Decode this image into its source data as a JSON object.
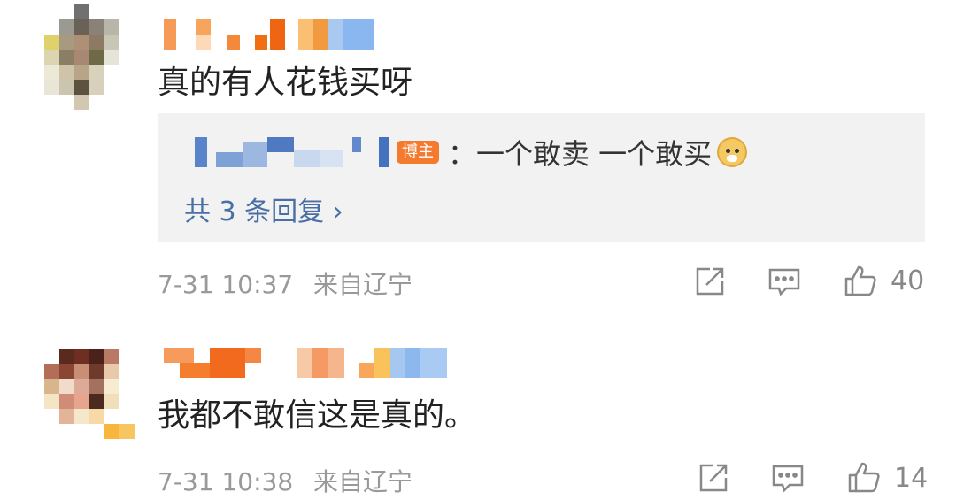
{
  "comments": [
    {
      "text": "真的有人花钱买呀",
      "reply": {
        "badge": "博主",
        "text": "：一个敢卖 一个敢买",
        "emoji": "doge-emoji",
        "more": "共 3 条回复 ›"
      },
      "date": "7-31 10:37",
      "location": "来自辽宁",
      "likes": "40"
    },
    {
      "text": "我都不敢信这是真的。",
      "date": "7-31 10:38",
      "location": "来自辽宁",
      "likes": "14"
    }
  ],
  "icons": {
    "share": "share-icon",
    "comment": "comment-icon",
    "like": "thumbs-up-icon"
  },
  "colors": {
    "reply_link": "#4a6fa5",
    "badge": "#f37a2f",
    "meta": "#999999",
    "reply_bg": "#f2f2f2"
  }
}
